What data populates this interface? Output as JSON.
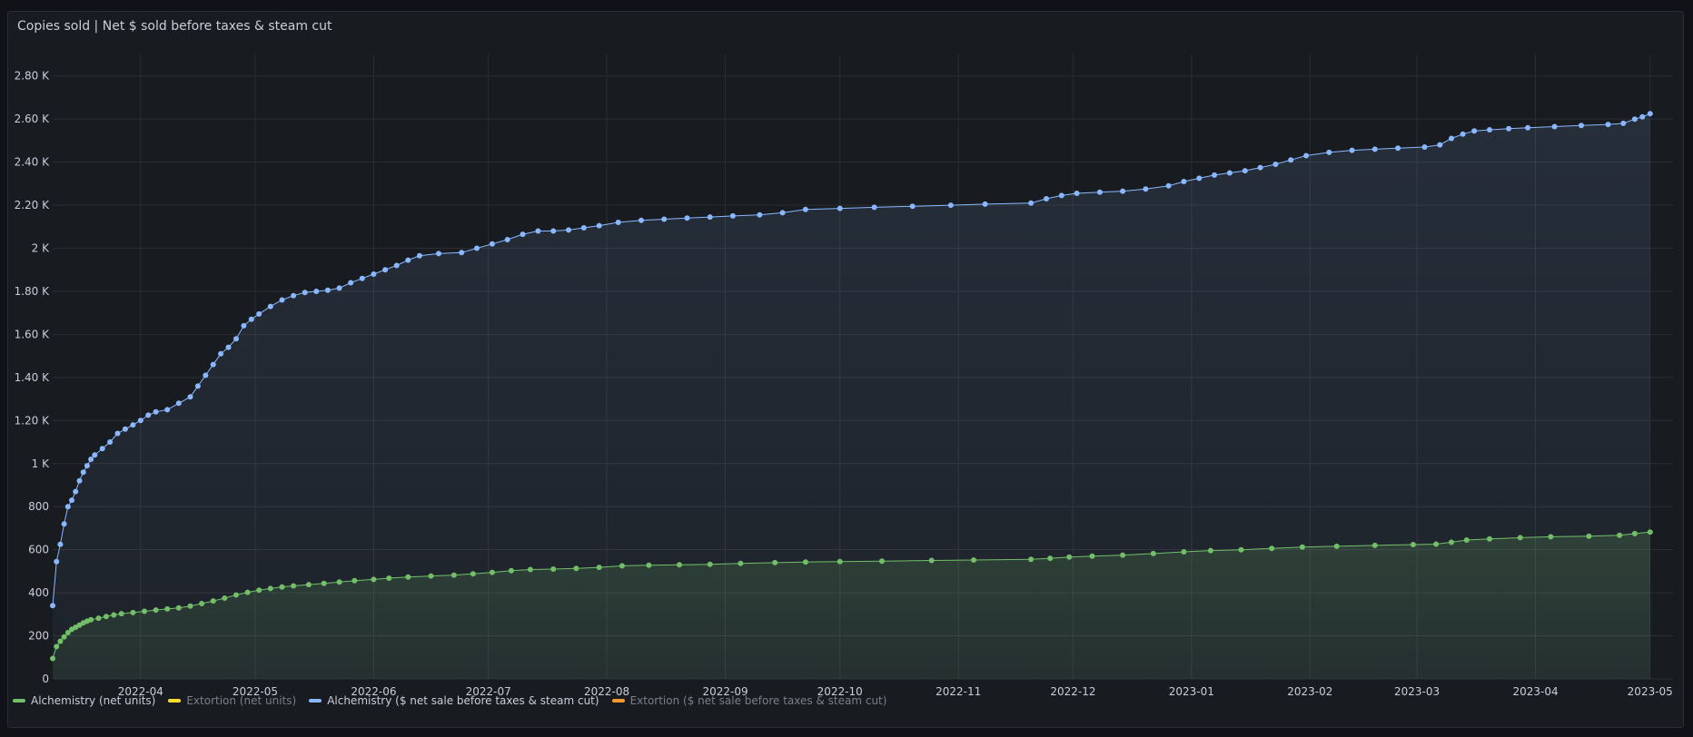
{
  "panel": {
    "title": "Copies sold | Net $ sold before taxes & steam cut"
  },
  "colors": {
    "green": "#73bf69",
    "yellow": "#fade2a",
    "blue": "#8ab8ff",
    "orange": "#ff9830",
    "grid": "#2b2e33",
    "text": "#ccccdc"
  },
  "legend": [
    {
      "label": "Alchemistry (net units)",
      "color": "#73bf69",
      "muted": false
    },
    {
      "label": "Extortion (net units)",
      "color": "#fade2a",
      "muted": true
    },
    {
      "label": "Alchemistry ($ net sale before taxes & steam cut)",
      "color": "#8ab8ff",
      "muted": false
    },
    {
      "label": "Extortion ($ net sale before taxes & steam cut)",
      "color": "#ff9830",
      "muted": true
    }
  ],
  "chart_data": {
    "type": "line",
    "title": "Copies sold | Net $ sold before taxes & steam cut",
    "xlabel": "",
    "ylabel": "",
    "ylim": [
      0,
      2900
    ],
    "xlim": [
      "2022-03-09",
      "2023-05-07"
    ],
    "grid": true,
    "legend_position": "bottom-left",
    "y_ticks": [
      "0",
      "200",
      "400",
      "600",
      "800",
      "1 K",
      "1.20 K",
      "1.40 K",
      "1.60 K",
      "1.80 K",
      "2 K",
      "2.20 K",
      "2.40 K",
      "2.60 K",
      "2.80 K"
    ],
    "y_tick_values": [
      0,
      200,
      400,
      600,
      800,
      1000,
      1200,
      1400,
      1600,
      1800,
      2000,
      2200,
      2400,
      2600,
      2800
    ],
    "x_ticks": [
      "2022-04",
      "2022-05",
      "2022-06",
      "2022-07",
      "2022-08",
      "2022-09",
      "2022-10",
      "2022-11",
      "2022-12",
      "2023-01",
      "2023-02",
      "2023-03",
      "2023-04",
      "2023-05"
    ],
    "x_tick_dates": [
      "2022-04-01",
      "2022-05-01",
      "2022-06-01",
      "2022-07-01",
      "2022-08-01",
      "2022-09-01",
      "2022-10-01",
      "2022-11-01",
      "2022-12-01",
      "2023-01-01",
      "2023-02-01",
      "2023-03-01",
      "2023-04-01",
      "2023-05-01"
    ],
    "series": [
      {
        "name": "Alchemistry ($ net sale before taxes & steam cut)",
        "color": "#8ab8ff",
        "points": [
          [
            "2022-03-09",
            340
          ],
          [
            "2022-03-10",
            545
          ],
          [
            "2022-03-11",
            625
          ],
          [
            "2022-03-12",
            720
          ],
          [
            "2022-03-13",
            800
          ],
          [
            "2022-03-14",
            830
          ],
          [
            "2022-03-15",
            870
          ],
          [
            "2022-03-16",
            920
          ],
          [
            "2022-03-17",
            960
          ],
          [
            "2022-03-18",
            990
          ],
          [
            "2022-03-19",
            1020
          ],
          [
            "2022-03-20",
            1040
          ],
          [
            "2022-03-22",
            1070
          ],
          [
            "2022-03-24",
            1100
          ],
          [
            "2022-03-26",
            1140
          ],
          [
            "2022-03-28",
            1160
          ],
          [
            "2022-03-30",
            1180
          ],
          [
            "2022-04-01",
            1200
          ],
          [
            "2022-04-03",
            1225
          ],
          [
            "2022-04-05",
            1240
          ],
          [
            "2022-04-08",
            1250
          ],
          [
            "2022-04-11",
            1280
          ],
          [
            "2022-04-14",
            1310
          ],
          [
            "2022-04-16",
            1360
          ],
          [
            "2022-04-18",
            1410
          ],
          [
            "2022-04-20",
            1460
          ],
          [
            "2022-04-22",
            1510
          ],
          [
            "2022-04-24",
            1540
          ],
          [
            "2022-04-26",
            1580
          ],
          [
            "2022-04-28",
            1640
          ],
          [
            "2022-04-30",
            1670
          ],
          [
            "2022-05-02",
            1695
          ],
          [
            "2022-05-05",
            1730
          ],
          [
            "2022-05-08",
            1760
          ],
          [
            "2022-05-11",
            1780
          ],
          [
            "2022-05-14",
            1795
          ],
          [
            "2022-05-17",
            1800
          ],
          [
            "2022-05-20",
            1805
          ],
          [
            "2022-05-23",
            1815
          ],
          [
            "2022-05-26",
            1840
          ],
          [
            "2022-05-29",
            1860
          ],
          [
            "2022-06-01",
            1880
          ],
          [
            "2022-06-04",
            1900
          ],
          [
            "2022-06-07",
            1920
          ],
          [
            "2022-06-10",
            1945
          ],
          [
            "2022-06-13",
            1965
          ],
          [
            "2022-06-18",
            1975
          ],
          [
            "2022-06-24",
            1980
          ],
          [
            "2022-06-28",
            2000
          ],
          [
            "2022-07-02",
            2020
          ],
          [
            "2022-07-06",
            2040
          ],
          [
            "2022-07-10",
            2065
          ],
          [
            "2022-07-14",
            2080
          ],
          [
            "2022-07-18",
            2080
          ],
          [
            "2022-07-22",
            2085
          ],
          [
            "2022-07-26",
            2095
          ],
          [
            "2022-07-30",
            2105
          ],
          [
            "2022-08-04",
            2120
          ],
          [
            "2022-08-10",
            2130
          ],
          [
            "2022-08-16",
            2135
          ],
          [
            "2022-08-22",
            2140
          ],
          [
            "2022-08-28",
            2145
          ],
          [
            "2022-09-03",
            2150
          ],
          [
            "2022-09-10",
            2155
          ],
          [
            "2022-09-16",
            2165
          ],
          [
            "2022-09-22",
            2180
          ],
          [
            "2022-10-01",
            2185
          ],
          [
            "2022-10-10",
            2190
          ],
          [
            "2022-10-20",
            2195
          ],
          [
            "2022-10-30",
            2200
          ],
          [
            "2022-11-08",
            2205
          ],
          [
            "2022-11-20",
            2210
          ],
          [
            "2022-11-24",
            2230
          ],
          [
            "2022-11-28",
            2245
          ],
          [
            "2022-12-02",
            2255
          ],
          [
            "2022-12-08",
            2260
          ],
          [
            "2022-12-14",
            2265
          ],
          [
            "2022-12-20",
            2275
          ],
          [
            "2022-12-26",
            2290
          ],
          [
            "2022-12-30",
            2310
          ],
          [
            "2023-01-03",
            2325
          ],
          [
            "2023-01-07",
            2340
          ],
          [
            "2023-01-11",
            2350
          ],
          [
            "2023-01-15",
            2360
          ],
          [
            "2023-01-19",
            2375
          ],
          [
            "2023-01-23",
            2390
          ],
          [
            "2023-01-27",
            2410
          ],
          [
            "2023-01-31",
            2430
          ],
          [
            "2023-02-06",
            2445
          ],
          [
            "2023-02-12",
            2455
          ],
          [
            "2023-02-18",
            2460
          ],
          [
            "2023-02-24",
            2465
          ],
          [
            "2023-03-03",
            2470
          ],
          [
            "2023-03-07",
            2480
          ],
          [
            "2023-03-10",
            2510
          ],
          [
            "2023-03-13",
            2530
          ],
          [
            "2023-03-16",
            2545
          ],
          [
            "2023-03-20",
            2550
          ],
          [
            "2023-03-25",
            2555
          ],
          [
            "2023-03-30",
            2560
          ],
          [
            "2023-04-06",
            2565
          ],
          [
            "2023-04-13",
            2570
          ],
          [
            "2023-04-20",
            2575
          ],
          [
            "2023-04-24",
            2580
          ],
          [
            "2023-04-27",
            2600
          ],
          [
            "2023-04-29",
            2610
          ],
          [
            "2023-05-01",
            2625
          ]
        ]
      },
      {
        "name": "Alchemistry (net units)",
        "color": "#73bf69",
        "points": [
          [
            "2022-03-09",
            95
          ],
          [
            "2022-03-10",
            150
          ],
          [
            "2022-03-11",
            175
          ],
          [
            "2022-03-12",
            195
          ],
          [
            "2022-03-13",
            215
          ],
          [
            "2022-03-14",
            230
          ],
          [
            "2022-03-15",
            240
          ],
          [
            "2022-03-16",
            250
          ],
          [
            "2022-03-17",
            260
          ],
          [
            "2022-03-18",
            268
          ],
          [
            "2022-03-19",
            275
          ],
          [
            "2022-03-21",
            282
          ],
          [
            "2022-03-23",
            290
          ],
          [
            "2022-03-25",
            297
          ],
          [
            "2022-03-27",
            303
          ],
          [
            "2022-03-30",
            308
          ],
          [
            "2022-04-02",
            314
          ],
          [
            "2022-04-05",
            320
          ],
          [
            "2022-04-08",
            325
          ],
          [
            "2022-04-11",
            330
          ],
          [
            "2022-04-14",
            338
          ],
          [
            "2022-04-17",
            350
          ],
          [
            "2022-04-20",
            362
          ],
          [
            "2022-04-23",
            375
          ],
          [
            "2022-04-26",
            390
          ],
          [
            "2022-04-29",
            402
          ],
          [
            "2022-05-02",
            412
          ],
          [
            "2022-05-05",
            420
          ],
          [
            "2022-05-08",
            427
          ],
          [
            "2022-05-11",
            432
          ],
          [
            "2022-05-15",
            438
          ],
          [
            "2022-05-19",
            444
          ],
          [
            "2022-05-23",
            450
          ],
          [
            "2022-05-27",
            456
          ],
          [
            "2022-06-01",
            462
          ],
          [
            "2022-06-05",
            468
          ],
          [
            "2022-06-10",
            473
          ],
          [
            "2022-06-16",
            478
          ],
          [
            "2022-06-22",
            482
          ],
          [
            "2022-06-27",
            488
          ],
          [
            "2022-07-02",
            495
          ],
          [
            "2022-07-07",
            503
          ],
          [
            "2022-07-12",
            508
          ],
          [
            "2022-07-18",
            510
          ],
          [
            "2022-07-24",
            513
          ],
          [
            "2022-07-30",
            518
          ],
          [
            "2022-08-05",
            525
          ],
          [
            "2022-08-12",
            528
          ],
          [
            "2022-08-20",
            530
          ],
          [
            "2022-08-28",
            532
          ],
          [
            "2022-09-05",
            536
          ],
          [
            "2022-09-14",
            540
          ],
          [
            "2022-09-22",
            543
          ],
          [
            "2022-10-01",
            545
          ],
          [
            "2022-10-12",
            547
          ],
          [
            "2022-10-25",
            550
          ],
          [
            "2022-11-05",
            552
          ],
          [
            "2022-11-20",
            555
          ],
          [
            "2022-11-25",
            560
          ],
          [
            "2022-11-30",
            566
          ],
          [
            "2022-12-06",
            570
          ],
          [
            "2022-12-14",
            575
          ],
          [
            "2022-12-22",
            582
          ],
          [
            "2022-12-30",
            590
          ],
          [
            "2023-01-06",
            596
          ],
          [
            "2023-01-14",
            600
          ],
          [
            "2023-01-22",
            606
          ],
          [
            "2023-01-30",
            612
          ],
          [
            "2023-02-08",
            616
          ],
          [
            "2023-02-18",
            620
          ],
          [
            "2023-02-28",
            624
          ],
          [
            "2023-03-06",
            626
          ],
          [
            "2023-03-10",
            635
          ],
          [
            "2023-03-14",
            645
          ],
          [
            "2023-03-20",
            650
          ],
          [
            "2023-03-28",
            656
          ],
          [
            "2023-04-05",
            660
          ],
          [
            "2023-04-15",
            663
          ],
          [
            "2023-04-23",
            667
          ],
          [
            "2023-04-27",
            675
          ],
          [
            "2023-05-01",
            682
          ]
        ]
      }
    ]
  }
}
